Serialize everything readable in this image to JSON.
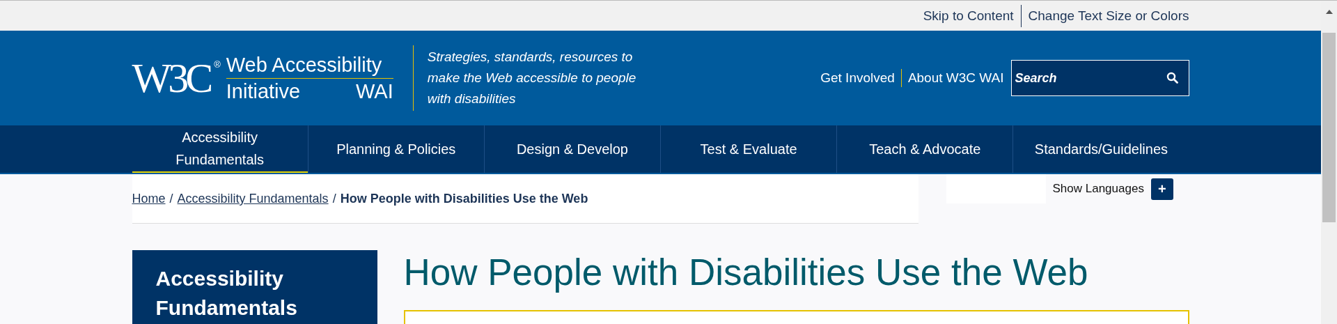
{
  "utility_links": [
    {
      "label": "Skip to Content"
    },
    {
      "label": "Change Text Size or Colors"
    }
  ],
  "header": {
    "logo": {
      "mark": "W3C",
      "registered": "®",
      "line1": "Web Accessibility",
      "line2_left": "Initiative",
      "line2_right": "WAI"
    },
    "tagline": "Strategies, standards, resources to make the Web accessible to people with disabilities",
    "links": [
      "Get Involved",
      "About W3C WAI"
    ],
    "search": {
      "placeholder": "Search"
    }
  },
  "nav": [
    {
      "label": "Accessibility Fundamentals",
      "selected": true
    },
    {
      "label": "Planning & Policies",
      "selected": false
    },
    {
      "label": "Design & Develop",
      "selected": false
    },
    {
      "label": "Test & Evaluate",
      "selected": false
    },
    {
      "label": "Teach & Advocate",
      "selected": false
    },
    {
      "label": "Standards/Guidelines",
      "selected": false
    }
  ],
  "breadcrumb": [
    {
      "label": "Home",
      "kind": "link"
    },
    {
      "label": "/",
      "kind": "separator"
    },
    {
      "label": "Accessibility Fundamentals",
      "kind": "link"
    },
    {
      "label": "/",
      "kind": "separator"
    },
    {
      "label": "How People with Disabilities Use the Web",
      "kind": "current"
    }
  ],
  "languages": {
    "label": "Show Languages",
    "button": "+"
  },
  "sidebar": {
    "title": "Accessibility Fundamentals"
  },
  "page_title": "How People with Disabilities Use the Web"
}
